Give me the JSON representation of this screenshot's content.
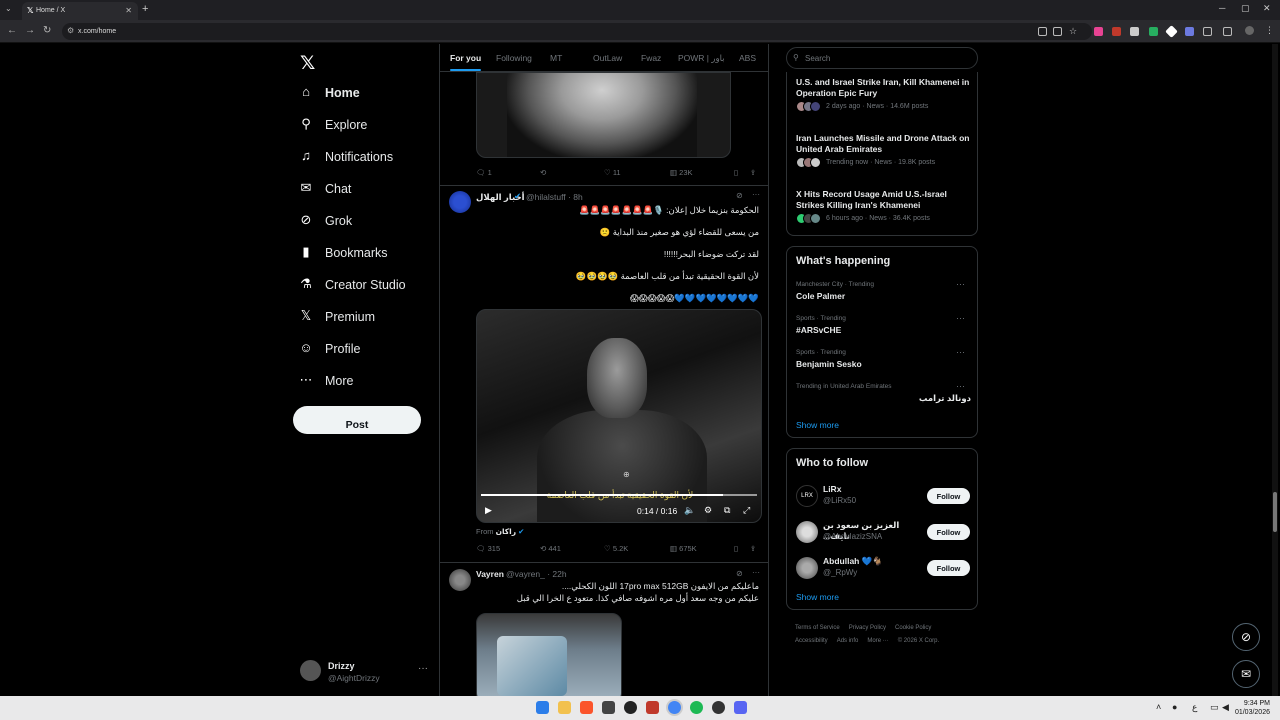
{
  "browser": {
    "tab_title": "Home / X",
    "url": "x.com/home",
    "new_tab": "+"
  },
  "nav": {
    "items": [
      {
        "label": "Home",
        "icon": "home-icon",
        "glyph": "⌂"
      },
      {
        "label": "Explore",
        "icon": "search-icon",
        "glyph": "⚲"
      },
      {
        "label": "Notifications",
        "icon": "bell-icon",
        "glyph": "♫"
      },
      {
        "label": "Chat",
        "icon": "mail-icon",
        "glyph": "✉"
      },
      {
        "label": "Grok",
        "icon": "grok-icon",
        "glyph": "⊘"
      },
      {
        "label": "Bookmarks",
        "icon": "bookmark-icon",
        "glyph": "▮"
      },
      {
        "label": "Creator Studio",
        "icon": "flask-icon",
        "glyph": "⚗"
      },
      {
        "label": "Premium",
        "icon": "x-icon",
        "glyph": "𝕏"
      },
      {
        "label": "Profile",
        "icon": "person-icon",
        "glyph": "☺"
      },
      {
        "label": "More",
        "icon": "more-circle-icon",
        "glyph": "⋯"
      }
    ],
    "post_label": "Post",
    "account_name": "Drizzy",
    "account_handle": "@AightDrizzy"
  },
  "timeline": {
    "tabs": [
      "For you",
      "Following",
      "MT",
      "OutLaw",
      "Fwaz",
      "POWR | باور",
      "ABS"
    ],
    "tweet1_actions": {
      "replies": "1",
      "reposts": "",
      "likes": "11",
      "views": "23K"
    },
    "tweet2": {
      "name": "أخبار الهلال",
      "handle": "@hilalstuff · 8h",
      "lines": [
        "الحكومة بنزيما خلال إعلان: 🎙️🚨🚨🚨🚨🚨🚨🚨",
        "من يسعى للقضاء لؤي هو صغير منذ البداية 🙁",
        "لقد تركت ضوضاء البحر!!!!!!",
        "لأن القوة الحقيقية تبدأ من قلب العاصمة 🥹🥹🥹🥹",
        "💙💙💙💙💙💙💙💙😱😱😱😱😱"
      ],
      "video_caption": "لأن القوة الحقيقية تبدأ من قلب العاصمة",
      "video_time": "0:14 / 0:16",
      "video_progress": 0.875,
      "from_label": "From",
      "from_name": "راكان",
      "actions": {
        "replies": "315",
        "reposts": "441",
        "likes": "5.2K",
        "views": "675K"
      }
    },
    "tweet3": {
      "name": "Vayren",
      "handle": "@vayren_ · 22h",
      "lines": [
        "ماعليكم من الايفون 17pro max 512GB اللون الكحلي....",
        "عليكم من وجه سعد أول مره اشوفه صافي كذا. متعود ع الخرا الي قبل"
      ]
    }
  },
  "right": {
    "search_placeholder": "Search",
    "news": [
      {
        "headline": "U.S. and Israel Strike Iran, Kill Khamenei in Operation Epic Fury",
        "meta": "2 days ago · News · 14.6M posts"
      },
      {
        "headline": "Iran Launches Missile and Drone Attack on United Arab Emirates",
        "meta": "Trending now · News · 19.8K posts"
      },
      {
        "headline": "X Hits Record Usage Amid U.S.-Israel Strikes Killing Iran's Khamenei",
        "meta": "6 hours ago · News · 36.4K posts"
      }
    ],
    "happening_title": "What's happening",
    "trends": [
      {
        "context": "Manchester City · Trending",
        "name": "Cole Palmer"
      },
      {
        "context": "Sports · Trending",
        "name": "#ARSvCHE"
      },
      {
        "context": "Sports · Trending",
        "name": "Benjamin Sesko"
      },
      {
        "context": "Trending in United Arab Emirates",
        "name": "دونالد ترامب"
      }
    ],
    "show_more": "Show more",
    "wtf_title": "Who to follow",
    "follow_label": "Follow",
    "who_to_follow": [
      {
        "name": "LiRx",
        "handle": "@LiRx50"
      },
      {
        "name": "العزيز بن سعود بن نايف...",
        "handle": "@AbdulazizSNA"
      },
      {
        "name": "Abdullah 💙🐐",
        "handle": "@_RpWy"
      }
    ],
    "footer": [
      "Terms of Service",
      "Privacy Policy",
      "Cookie Policy",
      "Accessibility",
      "Ads info",
      "More ···",
      "© 2026 X Corp."
    ]
  },
  "taskbar": {
    "time": "9:34 PM",
    "date": "01/03/2026",
    "lang": "ع"
  },
  "colors": {
    "accent": "#1d9bf0",
    "bg": "#000000",
    "border": "#2f3336",
    "muted": "#71767b"
  }
}
